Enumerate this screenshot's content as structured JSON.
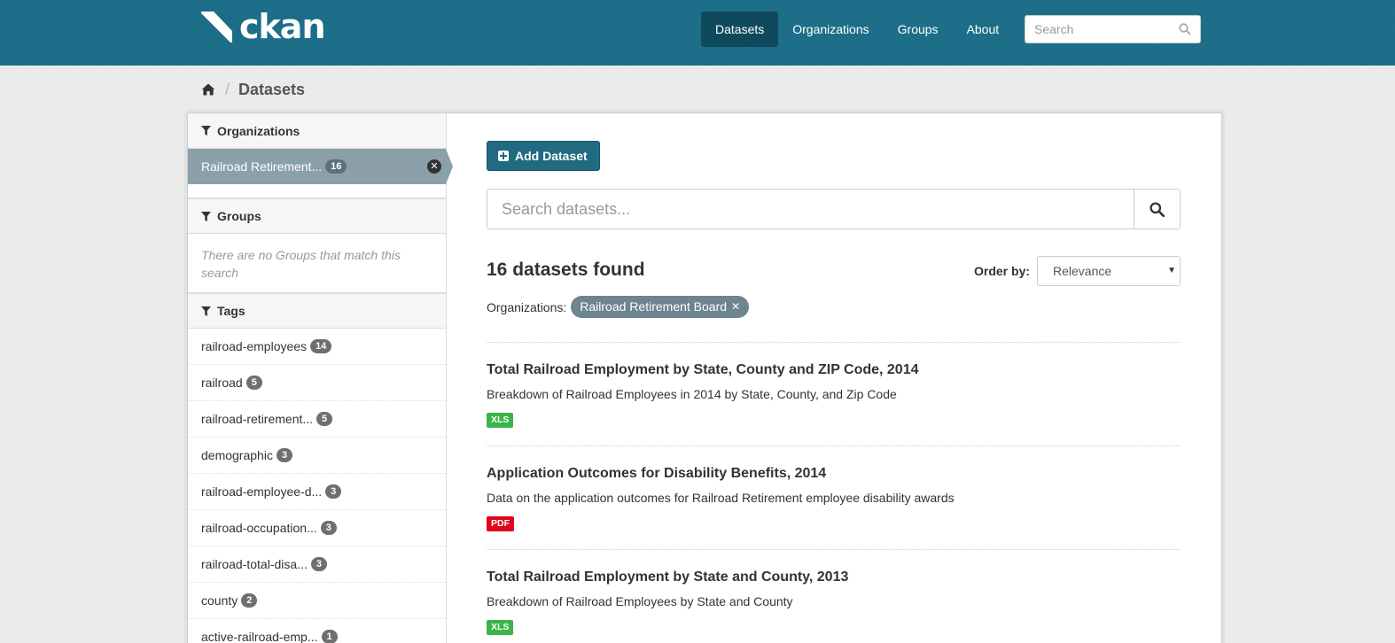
{
  "brand": {
    "name": "ckan"
  },
  "nav": {
    "items": [
      {
        "label": "Datasets",
        "active": true
      },
      {
        "label": "Organizations",
        "active": false
      },
      {
        "label": "Groups",
        "active": false
      },
      {
        "label": "About",
        "active": false
      }
    ],
    "search_placeholder": "Search"
  },
  "breadcrumb": {
    "current": "Datasets"
  },
  "sidebar": {
    "organizations": {
      "heading": "Organizations",
      "active_item": {
        "label": "Railroad Retirement...",
        "count": "16"
      }
    },
    "groups": {
      "heading": "Groups",
      "empty_text": "There are no Groups that match this search"
    },
    "tags": {
      "heading": "Tags",
      "items": [
        {
          "label": "railroad-employees",
          "count": "14"
        },
        {
          "label": "railroad",
          "count": "5"
        },
        {
          "label": "railroad-retirement...",
          "count": "5"
        },
        {
          "label": "demographic",
          "count": "3"
        },
        {
          "label": "railroad-employee-d...",
          "count": "3"
        },
        {
          "label": "railroad-occupation...",
          "count": "3"
        },
        {
          "label": "railroad-total-disa...",
          "count": "3"
        },
        {
          "label": "county",
          "count": "2"
        },
        {
          "label": "active-railroad-emp...",
          "count": "1"
        }
      ]
    }
  },
  "main": {
    "add_dataset_label": "Add Dataset",
    "search_placeholder": "Search datasets...",
    "found_text": "16 datasets found",
    "order_by_label": "Order by:",
    "order_by_value": "Relevance",
    "filter_label": "Organizations:",
    "filter_value": "Railroad Retirement Board",
    "datasets": [
      {
        "title": "Total Railroad Employment by State, County and ZIP Code, 2014",
        "notes": "Breakdown of Railroad Employees in 2014 by State, County, and Zip Code",
        "format": "XLS"
      },
      {
        "title": "Application Outcomes for Disability Benefits, 2014",
        "notes": "Data on the application outcomes for Railroad Retirement employee disability awards",
        "format": "PDF"
      },
      {
        "title": "Total Railroad Employment by State and County, 2013",
        "notes": "Breakdown of Railroad Employees by State and County",
        "format": "XLS"
      }
    ]
  },
  "colors": {
    "header_bg": "#1b6d87",
    "xls_badge": "#3ab54a",
    "pdf_badge": "#e0051e",
    "active_filter_bg": "#8ca0aa"
  }
}
